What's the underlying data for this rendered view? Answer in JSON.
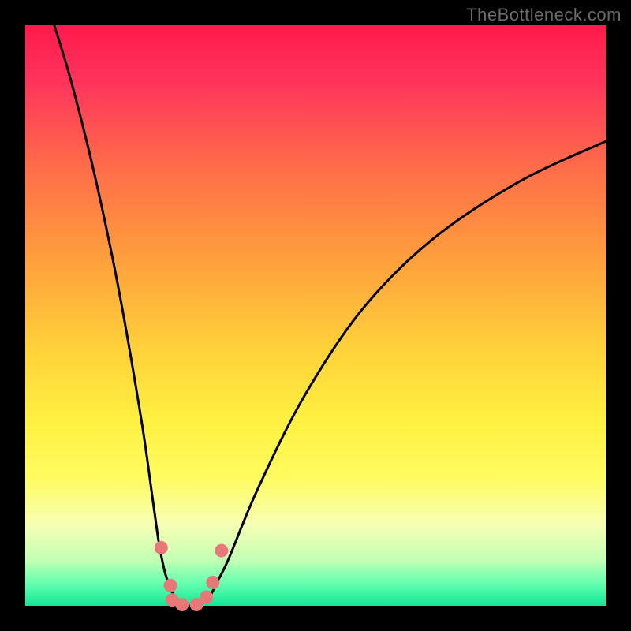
{
  "watermark": "TheBottleneck.com",
  "colors": {
    "frame": "#000000",
    "curve": "#000000",
    "dots": "#e87878",
    "gradient_stops": [
      "#ff1a4d",
      "#ff6b4a",
      "#ffcf3a",
      "#fffc60",
      "#c4ffb4",
      "#10e896"
    ]
  },
  "chart_data": {
    "type": "line",
    "title": "",
    "xlabel": "",
    "ylabel": "",
    "xlim": [
      0,
      100
    ],
    "ylim": [
      0,
      100
    ],
    "legend": false,
    "grid": false,
    "notes": "V-shaped bottleneck curve on red→green vertical gradient. Curve falls steeply from top-left, reaches ~0 at x≈26-30, rises asymptotically toward ~80 at right edge. Salmon dots cluster near the minimum.",
    "series": [
      {
        "name": "bottleneck_curve",
        "x": [
          5,
          8,
          12,
          16,
          20,
          22,
          23,
          24,
          25,
          26,
          27,
          28,
          29,
          30,
          31,
          32,
          33,
          35,
          40,
          48,
          58,
          70,
          85,
          100
        ],
        "values": [
          100,
          90,
          74,
          55,
          32,
          18,
          11,
          6,
          3,
          1,
          0,
          0,
          0,
          0,
          1,
          2,
          4,
          8,
          20,
          36,
          51,
          63,
          73,
          80
        ]
      }
    ],
    "dots": [
      {
        "x": 23.4,
        "y": 10
      },
      {
        "x": 25.0,
        "y": 3.5
      },
      {
        "x": 25.3,
        "y": 1.0
      },
      {
        "x": 27.0,
        "y": 0.2
      },
      {
        "x": 29.5,
        "y": 0.2
      },
      {
        "x": 31.2,
        "y": 1.5
      },
      {
        "x": 32.3,
        "y": 4.0
      },
      {
        "x": 33.8,
        "y": 9.5
      }
    ]
  }
}
